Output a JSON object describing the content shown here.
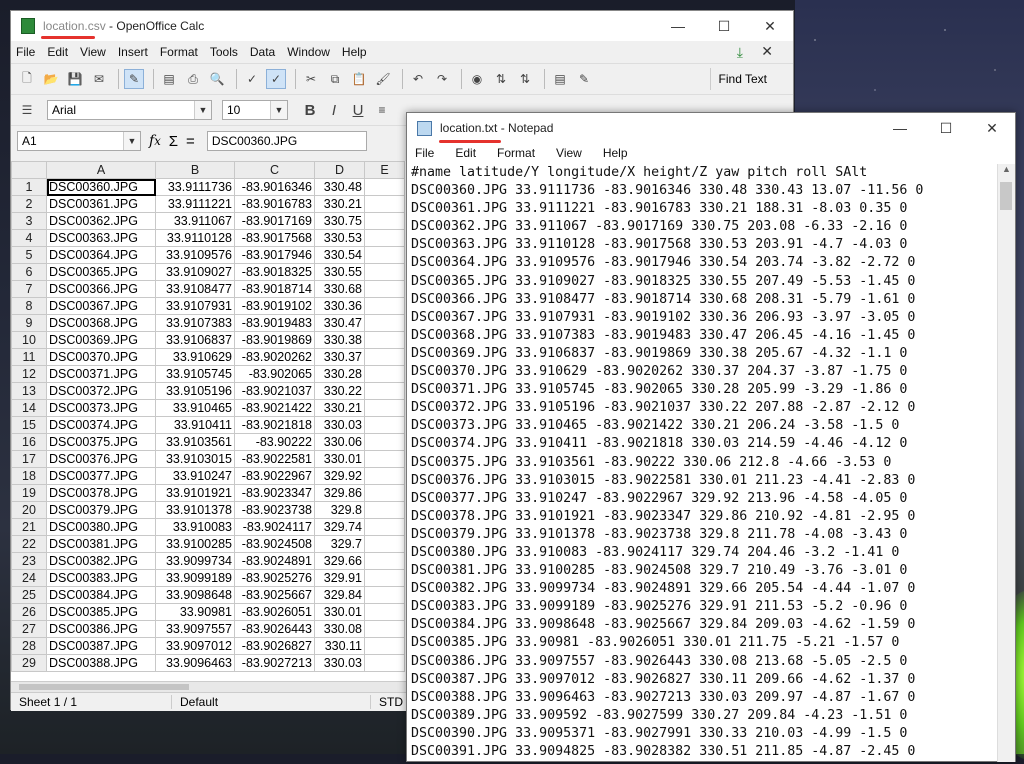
{
  "calc": {
    "title_file": "location.csv",
    "title_app": " - OpenOffice Calc",
    "menus": [
      "File",
      "Edit",
      "View",
      "Insert",
      "Format",
      "Tools",
      "Data",
      "Window",
      "Help"
    ],
    "find_text": "Find Text",
    "font_name": "Arial",
    "font_size": "10",
    "cell_ref": "A1",
    "formula_value": "DSC00360.JPG",
    "columns": [
      "A",
      "B",
      "C",
      "D",
      "E"
    ],
    "rows": [
      [
        "1",
        "DSC00360.JPG",
        "33.9111736",
        "-83.9016346",
        "330.48"
      ],
      [
        "2",
        "DSC00361.JPG",
        "33.9111221",
        "-83.9016783",
        "330.21"
      ],
      [
        "3",
        "DSC00362.JPG",
        "33.911067",
        "-83.9017169",
        "330.75"
      ],
      [
        "4",
        "DSC00363.JPG",
        "33.9110128",
        "-83.9017568",
        "330.53"
      ],
      [
        "5",
        "DSC00364.JPG",
        "33.9109576",
        "-83.9017946",
        "330.54"
      ],
      [
        "6",
        "DSC00365.JPG",
        "33.9109027",
        "-83.9018325",
        "330.55"
      ],
      [
        "7",
        "DSC00366.JPG",
        "33.9108477",
        "-83.9018714",
        "330.68"
      ],
      [
        "8",
        "DSC00367.JPG",
        "33.9107931",
        "-83.9019102",
        "330.36"
      ],
      [
        "9",
        "DSC00368.JPG",
        "33.9107383",
        "-83.9019483",
        "330.47"
      ],
      [
        "10",
        "DSC00369.JPG",
        "33.9106837",
        "-83.9019869",
        "330.38"
      ],
      [
        "11",
        "DSC00370.JPG",
        "33.910629",
        "-83.9020262",
        "330.37"
      ],
      [
        "12",
        "DSC00371.JPG",
        "33.9105745",
        "-83.902065",
        "330.28"
      ],
      [
        "13",
        "DSC00372.JPG",
        "33.9105196",
        "-83.9021037",
        "330.22"
      ],
      [
        "14",
        "DSC00373.JPG",
        "33.910465",
        "-83.9021422",
        "330.21"
      ],
      [
        "15",
        "DSC00374.JPG",
        "33.910411",
        "-83.9021818",
        "330.03"
      ],
      [
        "16",
        "DSC00375.JPG",
        "33.9103561",
        "-83.90222",
        "330.06"
      ],
      [
        "17",
        "DSC00376.JPG",
        "33.9103015",
        "-83.9022581",
        "330.01"
      ],
      [
        "18",
        "DSC00377.JPG",
        "33.910247",
        "-83.9022967",
        "329.92"
      ],
      [
        "19",
        "DSC00378.JPG",
        "33.9101921",
        "-83.9023347",
        "329.86"
      ],
      [
        "20",
        "DSC00379.JPG",
        "33.9101378",
        "-83.9023738",
        "329.8"
      ],
      [
        "21",
        "DSC00380.JPG",
        "33.910083",
        "-83.9024117",
        "329.74"
      ],
      [
        "22",
        "DSC00381.JPG",
        "33.9100285",
        "-83.9024508",
        "329.7"
      ],
      [
        "23",
        "DSC00382.JPG",
        "33.9099734",
        "-83.9024891",
        "329.66"
      ],
      [
        "24",
        "DSC00383.JPG",
        "33.9099189",
        "-83.9025276",
        "329.91"
      ],
      [
        "25",
        "DSC00384.JPG",
        "33.9098648",
        "-83.9025667",
        "329.84"
      ],
      [
        "26",
        "DSC00385.JPG",
        "33.90981",
        "-83.9026051",
        "330.01"
      ],
      [
        "27",
        "DSC00386.JPG",
        "33.9097557",
        "-83.9026443",
        "330.08"
      ],
      [
        "28",
        "DSC00387.JPG",
        "33.9097012",
        "-83.9026827",
        "330.11"
      ],
      [
        "29",
        "DSC00388.JPG",
        "33.9096463",
        "-83.9027213",
        "330.03"
      ]
    ],
    "status": {
      "sheet": "Sheet 1 / 1",
      "style": "Default",
      "mode": "STD"
    }
  },
  "notepad": {
    "title_file": "location.txt",
    "title_app": " - Notepad",
    "menus": [
      "File",
      "Edit",
      "Format",
      "View",
      "Help"
    ],
    "lines": [
      "#name latitude/Y longitude/X height/Z yaw pitch roll SAlt",
      "DSC00360.JPG 33.9111736 -83.9016346 330.48 330.43 13.07 -11.56 0",
      "DSC00361.JPG 33.9111221 -83.9016783 330.21 188.31 -8.03 0.35 0",
      "DSC00362.JPG 33.911067 -83.9017169 330.75 203.08 -6.33 -2.16 0",
      "DSC00363.JPG 33.9110128 -83.9017568 330.53 203.91 -4.7 -4.03 0",
      "DSC00364.JPG 33.9109576 -83.9017946 330.54 203.74 -3.82 -2.72 0",
      "DSC00365.JPG 33.9109027 -83.9018325 330.55 207.49 -5.53 -1.45 0",
      "DSC00366.JPG 33.9108477 -83.9018714 330.68 208.31 -5.79 -1.61 0",
      "DSC00367.JPG 33.9107931 -83.9019102 330.36 206.93 -3.97 -3.05 0",
      "DSC00368.JPG 33.9107383 -83.9019483 330.47 206.45 -4.16 -1.45 0",
      "DSC00369.JPG 33.9106837 -83.9019869 330.38 205.67 -4.32 -1.1 0",
      "DSC00370.JPG 33.910629 -83.9020262 330.37 204.37 -3.87 -1.75 0",
      "DSC00371.JPG 33.9105745 -83.902065 330.28 205.99 -3.29 -1.86 0",
      "DSC00372.JPG 33.9105196 -83.9021037 330.22 207.88 -2.87 -2.12 0",
      "DSC00373.JPG 33.910465 -83.9021422 330.21 206.24 -3.58 -1.5 0",
      "DSC00374.JPG 33.910411 -83.9021818 330.03 214.59 -4.46 -4.12 0",
      "DSC00375.JPG 33.9103561 -83.90222 330.06 212.8 -4.66 -3.53 0",
      "DSC00376.JPG 33.9103015 -83.9022581 330.01 211.23 -4.41 -2.83 0",
      "DSC00377.JPG 33.910247 -83.9022967 329.92 213.96 -4.58 -4.05 0",
      "DSC00378.JPG 33.9101921 -83.9023347 329.86 210.92 -4.81 -2.95 0",
      "DSC00379.JPG 33.9101378 -83.9023738 329.8 211.78 -4.08 -3.43 0",
      "DSC00380.JPG 33.910083 -83.9024117 329.74 204.46 -3.2 -1.41 0",
      "DSC00381.JPG 33.9100285 -83.9024508 329.7 210.49 -3.76 -3.01 0",
      "DSC00382.JPG 33.9099734 -83.9024891 329.66 205.54 -4.44 -1.07 0",
      "DSC00383.JPG 33.9099189 -83.9025276 329.91 211.53 -5.2 -0.96 0",
      "DSC00384.JPG 33.9098648 -83.9025667 329.84 209.03 -4.62 -1.59 0",
      "DSC00385.JPG 33.90981 -83.9026051 330.01 211.75 -5.21 -1.57 0",
      "DSC00386.JPG 33.9097557 -83.9026443 330.08 213.68 -5.05 -2.5 0",
      "DSC00387.JPG 33.9097012 -83.9026827 330.11 209.66 -4.62 -1.37 0",
      "DSC00388.JPG 33.9096463 -83.9027213 330.03 209.97 -4.87 -1.67 0",
      "DSC00389.JPG 33.909592 -83.9027599 330.27 209.84 -4.23 -1.51 0",
      "DSC00390.JPG 33.9095371 -83.9027991 330.33 210.03 -4.99 -1.5 0",
      "DSC00391.JPG 33.9094825 -83.9028382 330.51 211.85 -4.87 -2.45 0"
    ]
  },
  "colors": {
    "accent": "#2a7dd6",
    "annotation": "#e5322d"
  }
}
